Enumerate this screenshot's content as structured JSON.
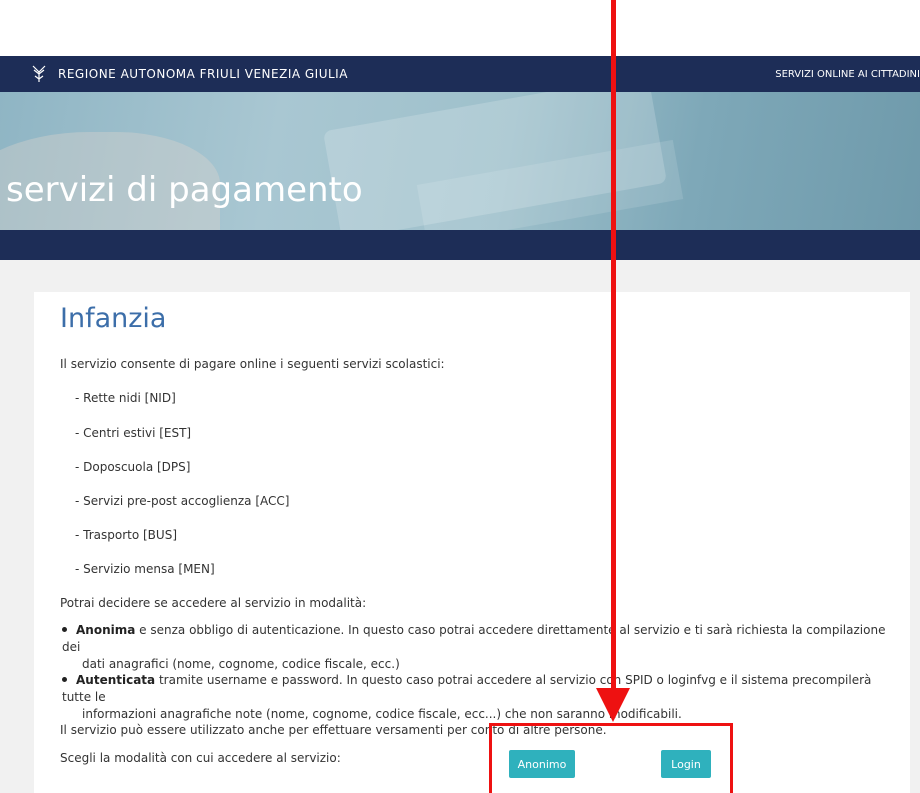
{
  "header": {
    "brand": "REGIONE AUTONOMA FRIULI VENEZIA GIULIA",
    "nav_link": "SERVIZI ONLINE AI CITTADINI"
  },
  "hero": {
    "title": "servizi di pagamento"
  },
  "main": {
    "title": "Infanzia",
    "intro": "Il servizio consente di pagare online i seguenti servizi scolastici:",
    "services": [
      "- Rette nidi [NID]",
      "- Centri estivi [EST]",
      "- Doposcuola [DPS]",
      "- Servizi pre-post accoglienza [ACC]",
      "- Trasporto [BUS]",
      "- Servizio mensa [MEN]"
    ],
    "mode_intro": "Potrai decidere se accedere al servizio in modalità:",
    "modes": [
      {
        "name": "Anonima",
        "line1": " e senza obbligo di autenticazione. In questo caso potrai accedere direttamente al servizio e ti sarà richiesta la compilazione dei",
        "line2": "dati anagrafici (nome, cognome, codice fiscale, ecc.)"
      },
      {
        "name": "Autenticata",
        "line1": " tramite username e password. In questo caso potrai accedere al servizio con SPID o loginfvg e il sistema precompilerà tutte le",
        "line2": "informazioni anagrafiche note (nome, cognome, codice fiscale, ecc...) che non saranno modificabili."
      }
    ],
    "others_note": "Il servizio può essere utilizzato anche per effettuare versamenti per conto di altre persone.",
    "choose_prompt": "Scegli la modalità con cui accedere al servizio:",
    "buttons": {
      "anonymous": "Anonimo",
      "login": "Login"
    }
  },
  "colors": {
    "header_bg": "#1d2d57",
    "title_blue": "#3c6ea9",
    "button_teal": "#2fb1bd",
    "annotation_red": "#ee1111"
  }
}
